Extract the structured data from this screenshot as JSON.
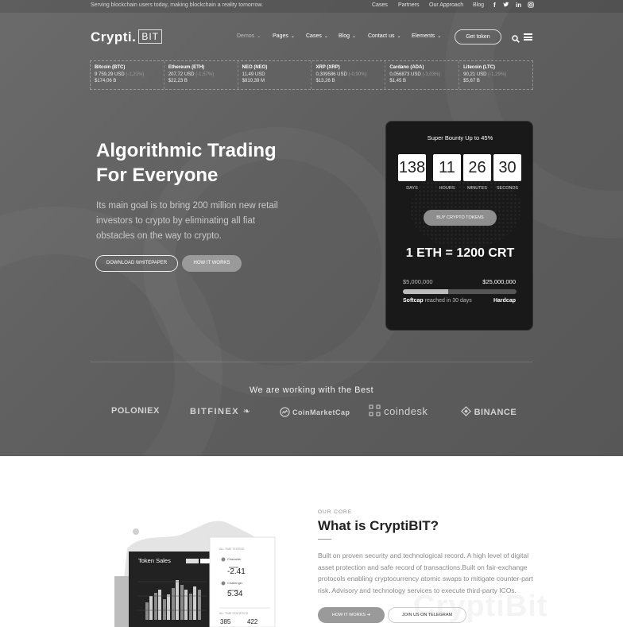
{
  "topbar": {
    "tagline": "Serving blockchain users today, making blockchain a reality tomorrow.",
    "links": [
      "Cases",
      "Partners",
      "Our Approach",
      "Blog"
    ],
    "social": [
      "f",
      "t",
      "in",
      "ig"
    ]
  },
  "logo": {
    "text": "Crypti.",
    "box": "BIT"
  },
  "nav": {
    "items": [
      "Demos",
      "Pages",
      "Cases",
      "Blog",
      "Contact us",
      "Elements"
    ],
    "cta": "Get token"
  },
  "ticker": [
    {
      "name": "Bitcoin (BTC)",
      "price": "9 759,29 USD",
      "change": "(-1,21%)",
      "cap": "$174,06 B"
    },
    {
      "name": "Ethereum (ETH)",
      "price": "207,72 USD",
      "change": "(-1,57%)",
      "cap": "$22,23 B"
    },
    {
      "name": "NEO (NEO)",
      "price": "11,49 USD",
      "change": "",
      "cap": "$810,39 M"
    },
    {
      "name": "XRP (XRP)",
      "price": "0,309586 USD",
      "change": "(-0,90%)",
      "cap": "$13,26 B"
    },
    {
      "name": "Cardano (ADA)",
      "price": "0,056873 USD",
      "change": "(-3,03%)",
      "cap": "$1,45 B"
    },
    {
      "name": "Litecoin (LTC)",
      "price": "90,21 USD",
      "change": "(-1,29%)",
      "cap": "$5,67 B"
    }
  ],
  "hero": {
    "headline_1": "Algorithmic Trading",
    "headline_2": "For Everyone",
    "lead": "Its main goal is to bring 200 million new retail investors to crypto by eliminating all fiat obstacles on the way to crypto.",
    "btn_whitepaper": "DOWNLOAD WHITEPAPER",
    "btn_how": "HOW IT WORKS"
  },
  "card": {
    "title": "Super Bounty Up to 45%",
    "countdown": [
      {
        "value": "138",
        "label": "DAYS"
      },
      {
        "value": "11",
        "label": "HOURS"
      },
      {
        "value": "26",
        "label": "MINUTES"
      },
      {
        "value": "30",
        "label": "SECONDS"
      }
    ],
    "buy": "BUY CRYPTO TOKENS",
    "rate": "1 ETH = 1200 CRT",
    "cap_min": "$5,000,000",
    "cap_max": "$25,000,000",
    "progress": 0.4,
    "softcap": "Softcap",
    "softcap_note": " reached in 30 days",
    "hardcap": "Hardcap"
  },
  "partners": {
    "title": "We are working with the Best",
    "names": [
      "POLONIEX",
      "BITFINEX",
      "CoinMarketCap",
      "coindesk",
      "BINANCE"
    ]
  },
  "about": {
    "label": "OUR CORE",
    "title": "What is CryptiBIT?",
    "text": "Built on proven security and technological record. A high level of digital asset protection and safe record of transactions.Built on fair-exchange protocols enabling cryptocurrency atomic swaps to mitigate counter-part risk. Advisory and technology services to execute third-party ICOs.",
    "ghost": "CryptiBit",
    "btn_how": "HOW IT WORKS",
    "btn_telegram": "JOIN US ON TELEGRAM"
  },
  "illustration": {
    "panel_title": "Token Sales",
    "side_header": "ALL TIME TESTING",
    "side_a": "Character",
    "side_a_value": "-2.41",
    "side_b": "Challenger",
    "side_b_value": "5.34",
    "footer_label": "ALL TIME STATISTICS",
    "stat_1": "385",
    "stat_2": "422"
  }
}
